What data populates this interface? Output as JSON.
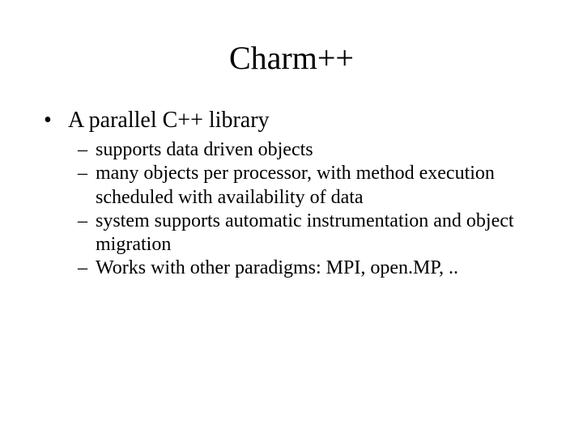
{
  "title": "Charm++",
  "main_point": "A parallel C++ library",
  "sub_points": [
    "supports data driven objects",
    "many objects per processor, with method execution scheduled with availability of data",
    "system supports automatic instrumentation and object migration",
    "Works with other paradigms: MPI, open.MP, .."
  ]
}
